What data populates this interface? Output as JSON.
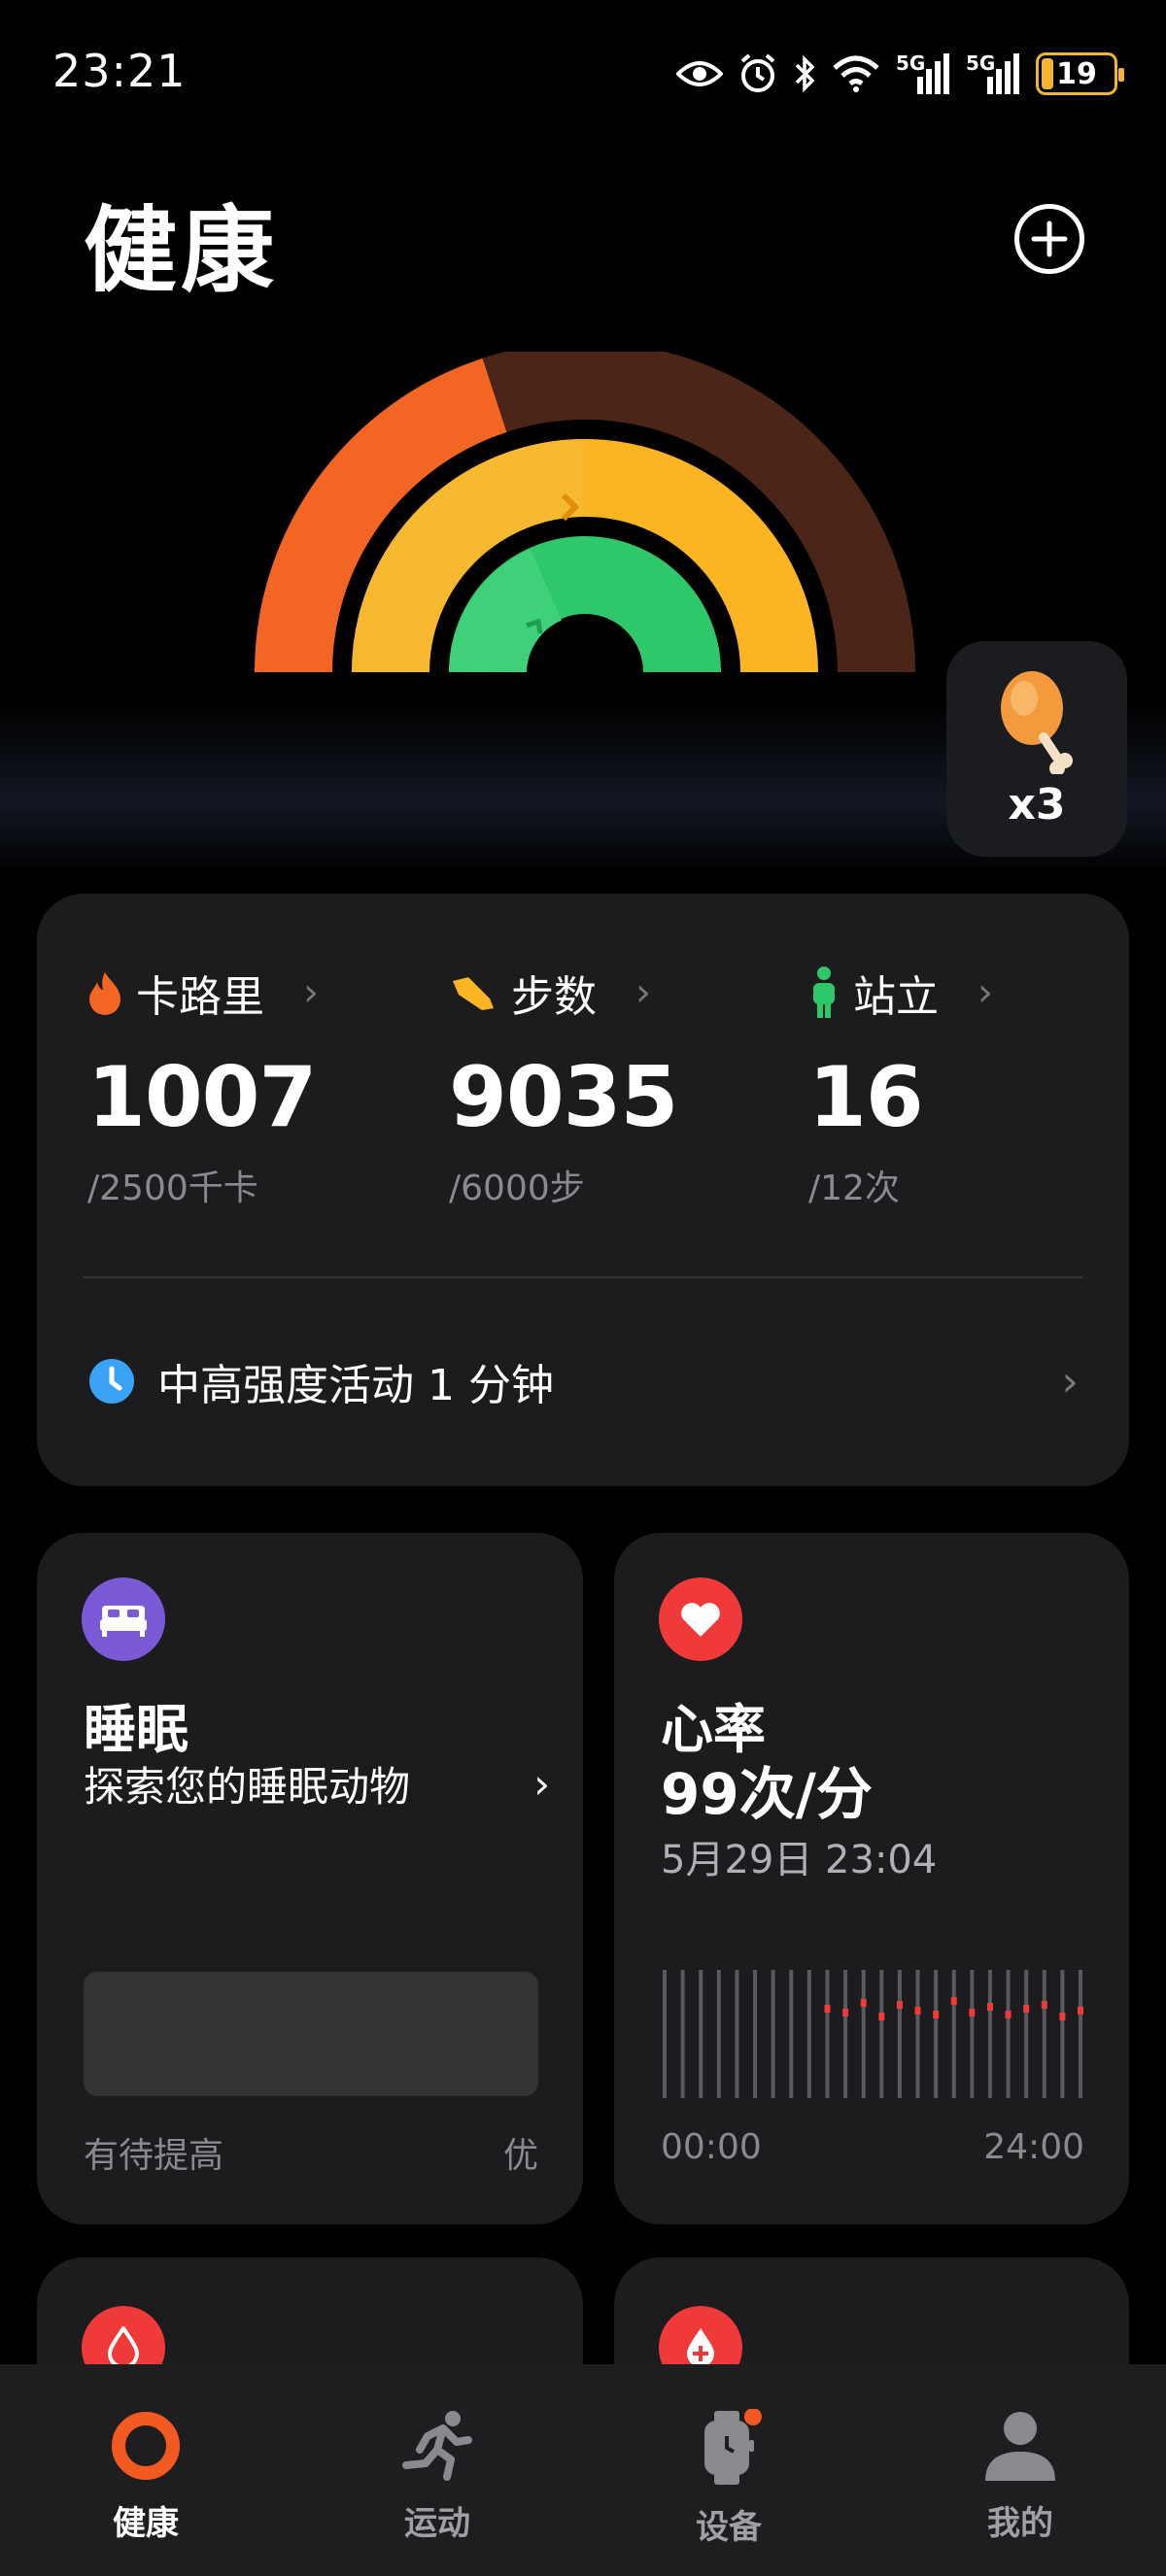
{
  "status": {
    "time": "23:21",
    "battery": "19",
    "network_1": "5G",
    "network_2": "5G"
  },
  "header": {
    "title": "健康"
  },
  "reward": {
    "count": "x3",
    "icon": "chicken-leg-icon"
  },
  "activity": {
    "calories": {
      "label": "卡路里",
      "value": "1007",
      "goal": "/2500千卡",
      "color": "#f26522"
    },
    "steps": {
      "label": "步数",
      "value": "9035",
      "goal": "/6000步",
      "color": "#fbb522"
    },
    "stand": {
      "label": "站立",
      "value": "16",
      "goal": "/12次",
      "color": "#2ec86b"
    },
    "intensity_text": "中高强度活动 1 分钟"
  },
  "sleep": {
    "title": "睡眠",
    "subtitle": "探索您的睡眠动物",
    "scale_low": "有待提高",
    "scale_high": "优"
  },
  "heart": {
    "title": "心率",
    "value": "99次/分",
    "time": "5月29日 23:04",
    "axis_start": "00:00",
    "axis_end": "24:00"
  },
  "nav": {
    "health": "健康",
    "exercise": "运动",
    "device": "设备",
    "me": "我的"
  },
  "colors": {
    "calories_ring": "#f26522",
    "steps_ring": "#fbb522",
    "stand_ring": "#2ec86b",
    "heart_accent": "#f03a3a",
    "sleep_accent": "#7a5ad6"
  }
}
